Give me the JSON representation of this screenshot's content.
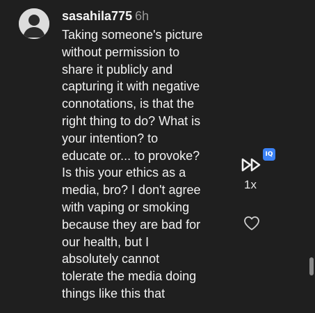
{
  "comment": {
    "username": "sasahila775",
    "time": "6h",
    "lines": [
      "Taking someone's picture",
      "without permission to",
      "share it publicly and",
      "capturing it with negative",
      "connotations, is that the",
      "right thing to do? What is",
      "your intention? to",
      "educate or... to provoke?",
      "Is this your ethics as a",
      "media, bro? I don't agree",
      "with vaping or smoking",
      "because they are bad for",
      "our health, but I",
      "absolutely cannot",
      "tolerate the media doing",
      "things like this that"
    ]
  },
  "controls": {
    "badge": "IQ",
    "speed": "1x"
  },
  "icons": {
    "avatar": "default-avatar-icon",
    "speed": "fast-forward-icon",
    "like": "heart-outline-icon"
  },
  "colors": {
    "background": "#1f1f1f",
    "text": "#f2f2f2",
    "muted": "#9a9a9a",
    "badge": "#3b82f6"
  }
}
